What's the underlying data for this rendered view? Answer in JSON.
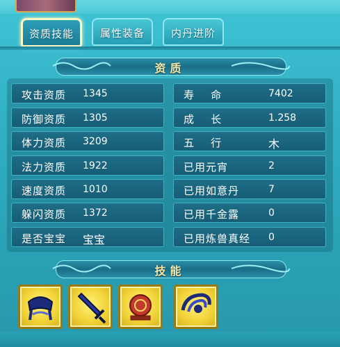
{
  "tabs": [
    {
      "label": "资质技能",
      "active": true
    },
    {
      "label": "属性装备",
      "active": false
    },
    {
      "label": "内丹进阶",
      "active": false
    }
  ],
  "aptitude": {
    "title": "资质",
    "left": [
      {
        "label": "攻击资质",
        "value": "1345"
      },
      {
        "label": "防御资质",
        "value": "1305"
      },
      {
        "label": "体力资质",
        "value": "3209"
      },
      {
        "label": "法力资质",
        "value": "1922"
      },
      {
        "label": "速度资质",
        "value": "1010"
      },
      {
        "label": "躲闪资质",
        "value": "1372"
      },
      {
        "label": "是否宝宝",
        "value": "宝宝"
      }
    ],
    "right": [
      {
        "label": "寿    命",
        "value": "7402"
      },
      {
        "label": "成    长",
        "value": "1.258"
      },
      {
        "label": "五    行",
        "value": "木"
      },
      {
        "label": "已用元宵",
        "value": "2"
      },
      {
        "label": "已用如意丹",
        "value": "7"
      },
      {
        "label": "已用千金露",
        "value": "0"
      },
      {
        "label": "已用炼兽真经",
        "value": "0"
      }
    ]
  },
  "skills": {
    "title": "技能",
    "icons": [
      "helmet-icon",
      "sword-icon",
      "shield-icon",
      "eye-icon"
    ]
  },
  "colors": {
    "accent": "#f6e6a6",
    "skill_bg": "#f2d43a",
    "row_bg": "#1e6d86"
  }
}
